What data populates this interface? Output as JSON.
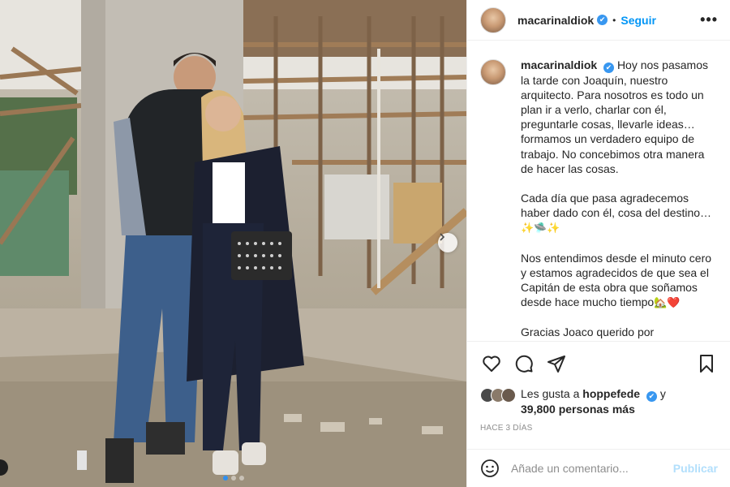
{
  "post": {
    "username": "macarinaldiok",
    "verified_mark": "✔",
    "separator": "•",
    "follow_label": "Seguir",
    "more_label": "•••"
  },
  "caption": {
    "username": "macarinaldiok",
    "paragraph1": "Hoy nos pasamos la tarde con Joaquín, nuestro arquitecto. Para nosotros es todo un plan ir a verlo, charlar con él, preguntarle cosas, llevarle ideas… formamos un verdadero equipo de trabajo. No concebimos otra manera de hacer las cosas.",
    "paragraph2": "Cada día que pasa agradecemos haber dado con él, cosa del destino…",
    "paragraph2_emojis": "✨🛸✨",
    "paragraph3": "Nos entendimos desde el minuto cero y estamos agradecidos de que sea el Capitán de esta obra que soñamos desde hace mucho tiempo",
    "paragraph3_emojis": "🏡❤️",
    "paragraph4": "Gracias Joaco querido por"
  },
  "likes": {
    "prefix": "Les gusta a",
    "liker": "hoppefede",
    "conjunction": "y",
    "others": "39,800 personas más"
  },
  "timestamp": "HACE 3 DÍAS",
  "comment": {
    "placeholder": "Añade un comentario...",
    "publish_label": "Publicar"
  },
  "icons": {
    "like": "heart-icon",
    "comment": "comment-icon",
    "share": "paper-plane-icon",
    "save": "bookmark-icon",
    "emoji": "smiley-icon",
    "next": "chevron-right-icon"
  },
  "colors": {
    "accent": "#0095f6",
    "verified": "#3897f0",
    "publish_disabled": "#b2dffc",
    "muted": "#8e8e8e",
    "active_dot": "#2f8ff0"
  },
  "carousel": {
    "slide_count": 3,
    "active_slide": 1
  }
}
